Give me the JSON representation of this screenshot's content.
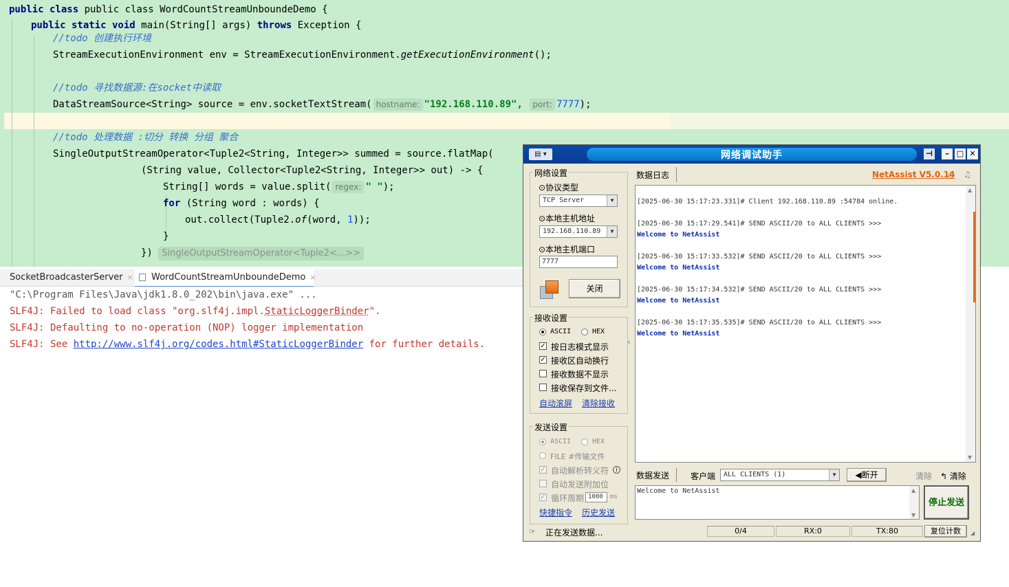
{
  "editor": {
    "lines": [
      {
        "id": "l1",
        "text": "public class WordCountStreamUnboundeDemo {"
      },
      {
        "id": "l2",
        "text": "public static void main(String[] args) throws Exception {"
      },
      {
        "id": "l3",
        "comment": "//todo 创建执行环境"
      },
      {
        "id": "l4",
        "text": "StreamExecutionEnvironment env = StreamExecutionEnvironment.getExecutionEnvironment();"
      },
      {
        "id": "l5",
        "comment": "//todo 寻找数据源:在socket中读取"
      },
      {
        "id": "l6",
        "pre": "DataStreamSource<String> source = env.socketTextStream(",
        "hint1": "hostname:",
        "str": "\"192.168.110.89\",",
        "hint2": "port:",
        "num": "7777",
        "post": ");"
      },
      {
        "id": "l7",
        "comment": "//todo 处理数据 :切分 转换 分组 聚合"
      },
      {
        "id": "l8",
        "text": "SingleOutputStreamOperator<Tuple2<String, Integer>> summed = source.flatMap("
      },
      {
        "id": "l9",
        "text": "(String value, Collector<Tuple2<String, Integer>> out) -> {"
      },
      {
        "id": "l10",
        "pre": "String[] words = value.split(",
        "hint": "regex:",
        "str": "\" \"",
        "post": ");"
      },
      {
        "id": "l11",
        "kw": "for",
        "text": " (String word : words) {"
      },
      {
        "id": "l12",
        "pre": "out.collect(Tuple2.",
        "it": "of",
        "mid": "(word, ",
        "num": "1",
        "post": "));"
      },
      {
        "id": "l13",
        "text": "}"
      },
      {
        "id": "l14",
        "text": "})",
        "fold": "SingleOutputStreamOperator<Tuple2<...>>"
      }
    ]
  },
  "tabs": [
    {
      "label": "SocketBroadcasterServer",
      "close": "×"
    },
    {
      "label": "WordCountStreamUnboundeDemo",
      "close": "×"
    }
  ],
  "console": {
    "cmd": "\"C:\\Program Files\\Java\\jdk1.8.0_202\\bin\\java.exe\" ...",
    "err1_pre": "SLF4J: Failed to load class \"org.slf4j.impl.",
    "err1_link": "StaticLoggerBinder",
    "err1_post": "\".",
    "err2": "SLF4J: Defaulting to no-operation (NOP) logger implementation",
    "err3_pre": "SLF4J: See ",
    "err3_link": "http://www.slf4j.org/codes.html#StaticLoggerBinder",
    "err3_post": " for further details."
  },
  "netassist": {
    "title": "网络调试助手",
    "brand": "NetAssist V5.0.14",
    "net": {
      "group": "网络设置",
      "protocol_label": "⊙协议类型",
      "protocol_value": "TCP Server",
      "host_label": "⊙本地主机地址",
      "host_value": "192.168.110.89",
      "port_label": "⊙本地主机端口",
      "port_value": "7777",
      "close_btn": "关闭"
    },
    "recv": {
      "group": "接收设置",
      "ascii": "ASCII",
      "hex": "HEX",
      "opt1": "按日志模式显示",
      "opt2": "接收区自动换行",
      "opt3": "接收数据不显示",
      "opt4": "接收保存到文件...",
      "link1": "自动滚屏",
      "link2": "清除接收"
    },
    "send": {
      "group": "发送设置",
      "ascii": "ASCII",
      "hex": "HEX",
      "file": "FILE #传输文件",
      "opt1": "自动解析转义符",
      "opt2": "自动发送附加位",
      "opt3": "循环周期",
      "period": "1000",
      "unit": "ms",
      "link1": "快捷指令",
      "link2": "历史发送"
    },
    "log_tab": "数据日志",
    "log": [
      {
        "header": "[2025-06-30 15:17:23.331]# Client 192.168.110.89 :54784 online.",
        "body": ""
      },
      {
        "header": "[2025-06-30 15:17:29.541]# SEND ASCII/20 to ALL CLIENTS >>>",
        "body": "Welcome to NetAssist"
      },
      {
        "header": "[2025-06-30 15:17:33.532]# SEND ASCII/20 to ALL CLIENTS >>>",
        "body": "Welcome to NetAssist"
      },
      {
        "header": "[2025-06-30 15:17:34.532]# SEND ASCII/20 to ALL CLIENTS >>>",
        "body": "Welcome to NetAssist"
      },
      {
        "header": "[2025-06-30 15:17:35.535]# SEND ASCII/20 to ALL CLIENTS >>>",
        "body": "Welcome to NetAssist"
      }
    ],
    "sendbar": {
      "tab": "数据发送",
      "client_label": "客户端",
      "client_value": "ALL CLIENTS (1)",
      "disconnect": "断开",
      "clear_dim": "清除",
      "clear": "清除",
      "text": "Welcome to NetAssist",
      "send_btn": "停止发送"
    },
    "status": {
      "text": "正在发送数据...",
      "count": "0/4",
      "rx": "RX:0",
      "tx": "TX:80",
      "reset": "复位计数"
    }
  }
}
